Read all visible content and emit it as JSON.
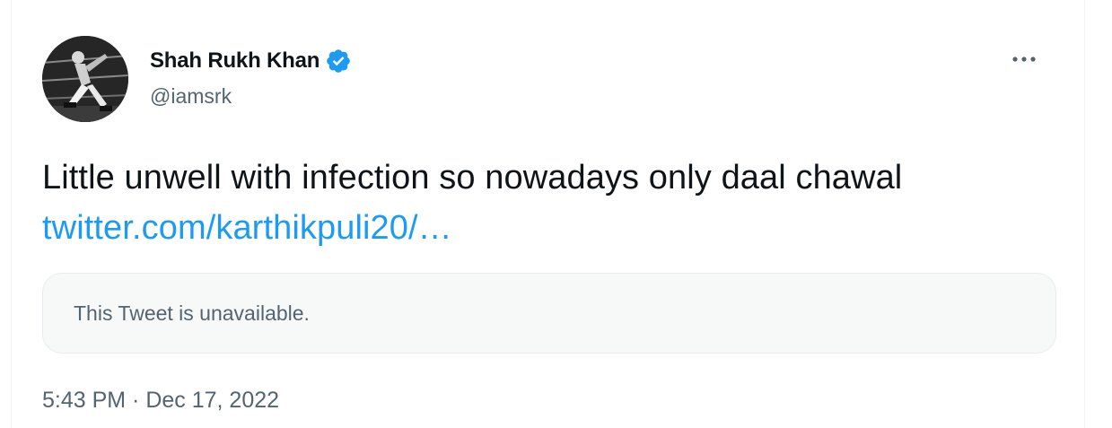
{
  "author": {
    "name": "Shah Rukh Khan",
    "handle": "@iamsrk",
    "verified": true,
    "verified_color": "#1d9bf0"
  },
  "tweet": {
    "text": "Little unwell with infection so nowadays only daal chawal",
    "link_text": "twitter.com/karthikpuli20/…",
    "link_color": "#1d9bf0",
    "quoted_notice": "This Tweet is unavailable.",
    "timestamp": "5:43 PM · Dec 17, 2022"
  },
  "icons": {
    "more": "more-horizontal-icon",
    "verified": "verified-badge-icon"
  }
}
